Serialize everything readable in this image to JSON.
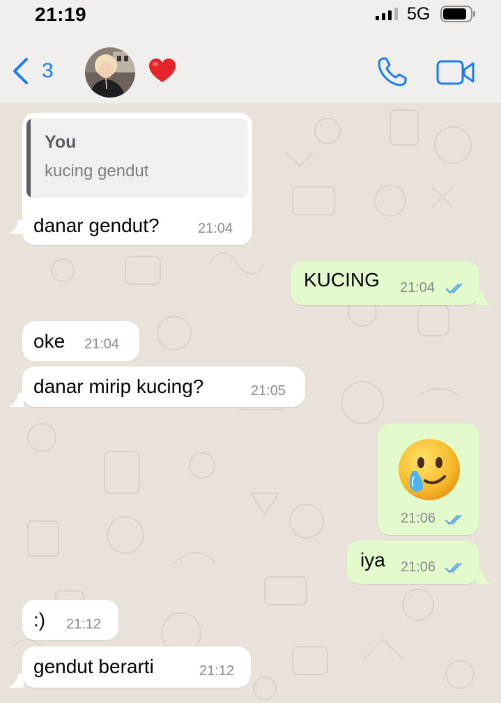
{
  "status_bar": {
    "time": "21:19",
    "network": "5G"
  },
  "header": {
    "back_count": "3",
    "contact_emoji": "red-heart",
    "colors": {
      "accent": "#1a7cf4"
    }
  },
  "messages": [
    {
      "direction": "incoming",
      "quote": {
        "author": "You",
        "text": "kucing gendut"
      },
      "text": "danar gendut?",
      "time": "21:04"
    },
    {
      "direction": "outgoing",
      "text": "KUCING",
      "time": "21:04",
      "status": "read"
    },
    {
      "direction": "incoming",
      "text": "oke",
      "time": "21:04"
    },
    {
      "direction": "incoming",
      "text": "danar mirip kucing?",
      "time": "21:05"
    },
    {
      "direction": "outgoing",
      "emoji": "face-holding-back-tears",
      "time": "21:06",
      "status": "read"
    },
    {
      "direction": "outgoing",
      "text": "iya",
      "time": "21:06",
      "status": "read"
    },
    {
      "direction": "incoming",
      "text": ":)",
      "time": "21:12"
    },
    {
      "direction": "incoming",
      "text": "gendut berarti",
      "time": "21:12"
    }
  ],
  "colors": {
    "incoming_bubble": "#ffffff",
    "outgoing_bubble": "#e3fbcc",
    "chat_background": "#e8e2da",
    "read_ticks": "#4fa3e8"
  }
}
